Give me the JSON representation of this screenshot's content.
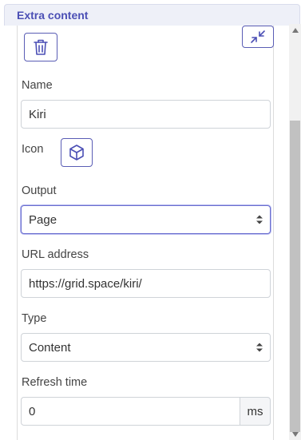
{
  "panel": {
    "title": "Extra content"
  },
  "form": {
    "name_label": "Name",
    "name_value": "Kiri",
    "icon_label": "Icon",
    "output_label": "Output",
    "output_value": "Page",
    "url_label": "URL address",
    "url_value": "https://grid.space/kiri/",
    "type_label": "Type",
    "type_value": "Content",
    "refresh_label": "Refresh time",
    "refresh_value": "0",
    "refresh_unit": "ms"
  },
  "icons": {
    "delete": "trash-icon",
    "collapse": "compress-icon",
    "selected_icon": "cube-icon"
  },
  "colors": {
    "accent": "#4b4fb5",
    "header_bg": "#eef0f8"
  }
}
